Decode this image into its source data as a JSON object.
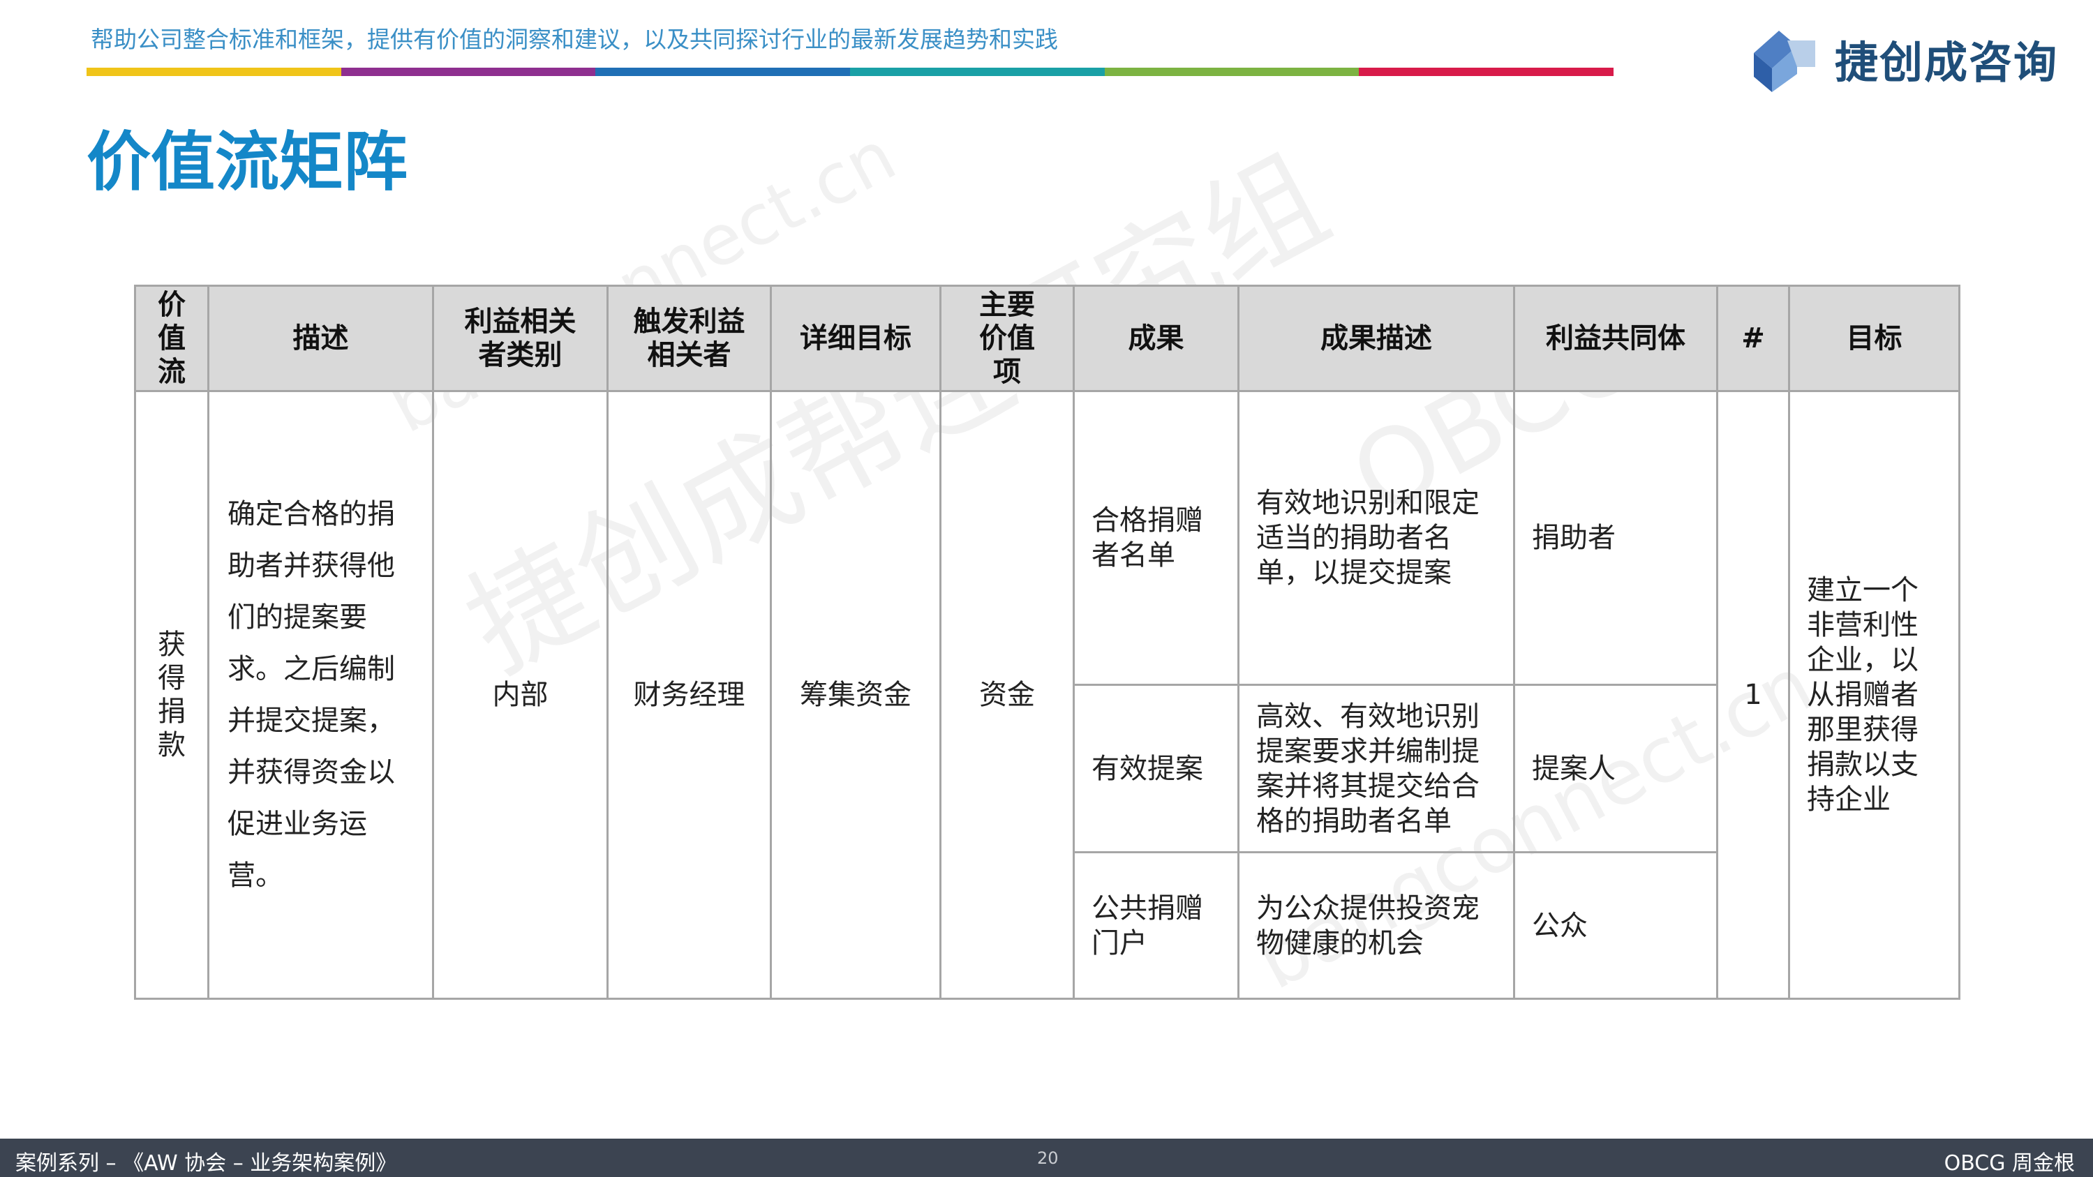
{
  "header": {
    "tagline": "帮助公司整合标准和框架，提供有价值的洞察和建议，以及共同探讨行业的最新发展趋势和实践",
    "stripe_colors": [
      "#f0c419",
      "#8e2f8f",
      "#1f6fb5",
      "#1aa0a6",
      "#7cb342",
      "#d81b4a"
    ],
    "logo_text": "捷创成咨询",
    "logo_icon": "cube-logo-icon"
  },
  "title": "价值流矩阵",
  "watermarks": [
    "捷创成帮连研究组",
    "bangconnect.cn",
    "bangconnect.cn",
    "OBCG"
  ],
  "table": {
    "headers": [
      "价值流",
      "描述",
      "利益相关者类别",
      "触发利益相关者",
      "详细目标",
      "主要价值项",
      "成果",
      "成果描述",
      "利益共同体",
      "#",
      "目标"
    ],
    "value_stream": "获得捐款",
    "description": "确定合格的捐助者并获得他们的提案要求。之后编制并提交提案，并获得资金以促进业务运营。",
    "stakeholder_category": "内部",
    "triggering_stakeholder": "财务经理",
    "detailed_objective": "筹集资金",
    "value_item": "资金",
    "outcomes": [
      {
        "outcome": "合格捐赠者名单",
        "outcome_desc": "有效地识别和限定适当的捐助者名单，以提交提案",
        "community": "捐助者"
      },
      {
        "outcome": "有效提案",
        "outcome_desc": "高效、有效地识别提案要求并编制提案并将其提交给合格的捐助者名单",
        "community": "提案人"
      },
      {
        "outcome": "公共捐赠门户",
        "outcome_desc": "为公众提供投资宠物健康的机会",
        "community": "公众"
      }
    ],
    "number": "1",
    "goal": "建立一个非营利性企业，以从捐赠者那里获得捐款以支持企业"
  },
  "footer": {
    "series": "案例系列 – 《AW 协会 – 业务架构案例》",
    "page": "20",
    "author": "OBCG 周金根"
  }
}
